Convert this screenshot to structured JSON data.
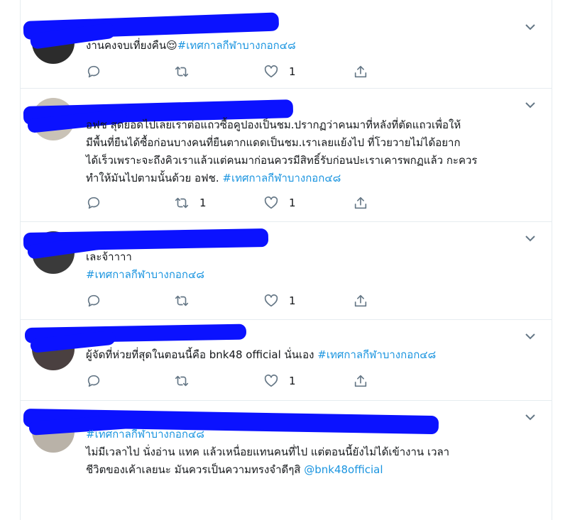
{
  "tweets": [
    {
      "text": "งานคงจบเที่ยงคืน😌",
      "hashtag": "#เทศกาลกีฬาบางกอก๔๘",
      "reply_count": "",
      "retweet_count": "",
      "like_count": "1"
    },
    {
      "line1": "อฟช สุดยอดไปเลยเราต่อแถวซื้อคูปองเป็นชม.ปรากฏว่าคนมาที่หลังที่ตัดแถวเพื่อให้",
      "line2": "มีพื้นที่ยืนได้ซื้อก่อนบางคนที่ยืนตากแดดเป็นชม.เราเลยแย้งไป ที่โวยวายไม่ได้อยาก",
      "line3": "ได้เร็วเพราะจะถึงคิวเราแล้วแต่คนมาก่อนควรมีสิทธิ์รับก่อนปะเราเคารพกฏแล้ว กะควร",
      "line4": "ทำให้มันไปตามนั้นด้วย อฟช.",
      "hashtag": "#เทศกาลกีฬาบางกอก๔๘",
      "reply_count": "",
      "retweet_count": "1",
      "like_count": "1"
    },
    {
      "text": "เละจ้าาาา",
      "hashtag": "#เทศกาลกีฬาบางกอก๔๘",
      "reply_count": "",
      "retweet_count": "",
      "like_count": "1"
    },
    {
      "text": "ผู้จัดที่ห่วยที่สุดในตอนนี้คือ bnk48 official นั่นเอง",
      "hashtag": "#เทศกาลกีฬาบางกอก๔๘",
      "reply_count": "",
      "retweet_count": "",
      "like_count": "1"
    },
    {
      "hashtag": "#เทศกาลกีฬาบางกอก๔๘",
      "line1": "ไม่มีเวลาไป นั่งอ่าน แทค แล้วเหนื่อยแทนคนที่ไป แต่ตอนนี้ยังไม่ได้เข้างาน เวลา",
      "line2": "ชีวิตของเค้าเลยนะ มันควรเป็นความทรงจำดีๆสิ",
      "mention": "@bnk48official"
    }
  ],
  "icons": {
    "reply": "reply-icon",
    "retweet": "retweet-icon",
    "like": "like-icon",
    "share": "share-icon",
    "more": "chevron-down-icon"
  },
  "colors": {
    "link": "#1b95e0",
    "icon": "#657786",
    "text": "#14171a",
    "redaction": "#0b12ff"
  }
}
